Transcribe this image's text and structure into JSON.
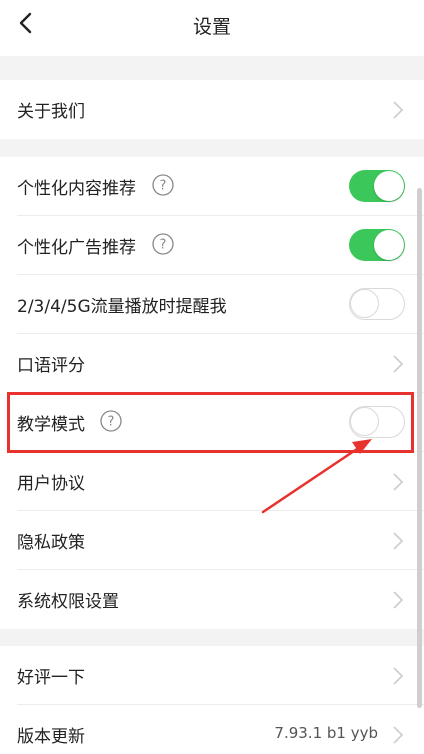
{
  "header": {
    "title": "设置",
    "back_icon": "chevron-left-icon"
  },
  "section1": {
    "items": [
      {
        "label": "关于我们",
        "control": "chevron"
      }
    ]
  },
  "section2": {
    "items": [
      {
        "label": "个性化内容推荐",
        "help": true,
        "control": "toggle",
        "state": "on"
      },
      {
        "label": "个性化广告推荐",
        "help": true,
        "control": "toggle",
        "state": "on"
      },
      {
        "label": "2/3/4/5G流量播放时提醒我",
        "help": false,
        "control": "toggle",
        "state": "off"
      },
      {
        "label": "口语评分",
        "help": false,
        "control": "chevron"
      },
      {
        "label": "教学模式",
        "help": true,
        "control": "toggle",
        "state": "off"
      },
      {
        "label": "用户协议",
        "help": false,
        "control": "chevron"
      },
      {
        "label": "隐私政策",
        "help": false,
        "control": "chevron"
      },
      {
        "label": "系统权限设置",
        "help": false,
        "control": "chevron"
      }
    ]
  },
  "section3": {
    "items": [
      {
        "label": "好评一下",
        "control": "chevron"
      },
      {
        "label": "版本更新",
        "control": "chevron",
        "value": "7.93.1 b1 yyb"
      }
    ]
  },
  "colors": {
    "toggle_on": "#3cc75a",
    "highlight": "#e8322e",
    "page_bg": "#f3f3f3"
  }
}
